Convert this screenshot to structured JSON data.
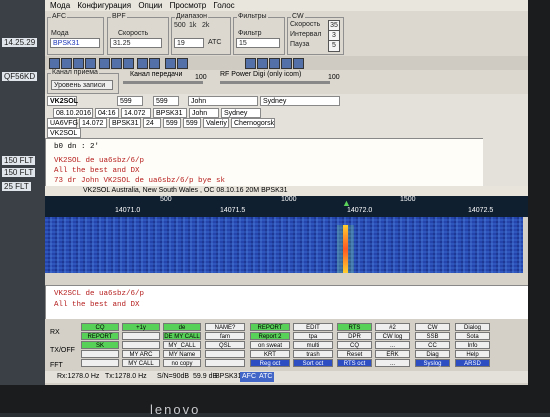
{
  "menu": [
    "Мода",
    "Конфигурация",
    "Опции",
    "Просмотр",
    "Голос"
  ],
  "panel": {
    "afc_label": "AFC",
    "mode_label": "Мода",
    "mode_value": "BPSK31",
    "bpf_label": "BPF",
    "speed_label": "Скорость",
    "speed_value": "31.25",
    "atc_label": "ATC",
    "diap_label": "Диапазон",
    "diap_vals": [
      "500",
      "1k",
      "2k"
    ],
    "center": "19",
    "filters_label": "Фильтры",
    "filter_label": "Фильтр",
    "filter_val": "15",
    "cw_label": "CW",
    "cw_labels": [
      "Скорость",
      "Интервал",
      "Пауза"
    ],
    "cw_vals": [
      "35",
      "3",
      "5"
    ]
  },
  "levels": {
    "tx_channel": "Канал приема",
    "tx_record": "Уровень записи",
    "rx_channel": "Канал передачи",
    "rx_value": "100",
    "power": "RF Power Digi (only icom)",
    "power_value": "100"
  },
  "qso": {
    "call": "VK2SOL",
    "hx": "599",
    "my": "599",
    "name": "John",
    "qth": "Sydney",
    "log": [
      "08.10.2016",
      "04:16",
      "14.072",
      "BPSK31",
      "John",
      "Sydney"
    ],
    "log2": [
      "UA6VFG",
      "14.072",
      "BPSK31",
      "24",
      "599",
      "599",
      "Valeriy",
      "Chernogorsk"
    ],
    "log3": "VK2SOL"
  },
  "rx": {
    "lines": [
      "b0 dn : 2'",
      "VK2SOL de ua6sbz/6/p",
      "All the best and DX",
      "73 dr John VK2SOL de ua6sbz/6/p bye sk"
    ],
    "status": "VK2SOL Australia, New South Wales , OC     08.10.16 20M BPSK31"
  },
  "ruler": {
    "ticks": [
      "500",
      "1000",
      "1500"
    ],
    "freq": [
      "14071.5",
      "14072.0",
      "14072.5"
    ],
    "freq_left": "14071.0"
  },
  "tx": {
    "lines": [
      "VK2SCL de ua6sbz/6/p",
      "All the best and DX"
    ]
  },
  "side": [
    "RX",
    "TX/OFF",
    "FFT"
  ],
  "macros": {
    "row1": [
      "CQ",
      "+1y",
      "de",
      "NAME?",
      "REPORT",
      "EDIT",
      "RTS",
      "#2",
      "CW",
      "Dialog"
    ],
    "row2": [
      "REPORT",
      "",
      "DE MY CALL",
      "fam",
      "Report 2",
      "tpa",
      "DPR",
      "CW log",
      "SSB",
      "Sota"
    ],
    "row3": [
      "SK",
      "",
      "MY_CALL",
      "QSL",
      "on sweat",
      "multi",
      "CQ",
      "...",
      "CC",
      "Info"
    ],
    "row4": [
      "",
      "MY ARC",
      "MY Name",
      "",
      "KRT",
      "trash",
      "Reset",
      "ERK",
      "Diag",
      "Help"
    ],
    "row5": [
      "",
      "MY CALL",
      "no copy",
      "",
      "Reg oct",
      "Sort oct",
      "RTS oct",
      "...",
      "Syslog",
      "ARSD"
    ]
  },
  "status": {
    "rx": "Rx:1278.0 Hz",
    "tx": "Tx:1278.0 Hz",
    "snr": "S/N=90dB",
    "ima": "59.9 dB",
    "mode": "BPSK31",
    "auto": "AFC",
    "ptt": "ATC"
  },
  "brand": "lenovo",
  "overlay": [
    "14.25.29",
    "QF56KD",
    "150 FLT",
    "150 FLT",
    "25 FLT"
  ]
}
